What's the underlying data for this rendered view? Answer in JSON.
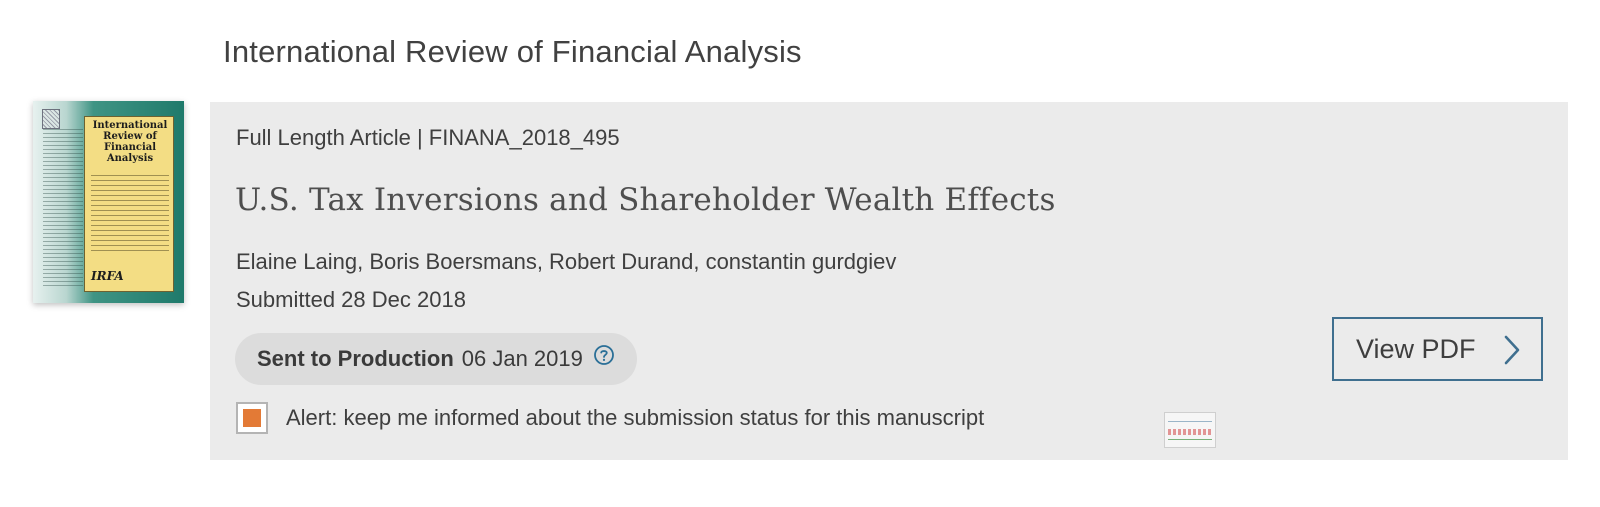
{
  "journal": {
    "title": "International Review of Financial Analysis",
    "cover": {
      "name_lines": "International\nReview of\nFinancial\nAnalysis",
      "abbreviation": "IRFA"
    }
  },
  "article": {
    "meta": "Full Length Article | FINANA_2018_495",
    "title": "U.S. Tax Inversions and Shareholder Wealth Effects",
    "authors": "Elaine Laing, Boris Boersmans, Robert Durand, constantin gurdgiev",
    "submitted": "Submitted 28 Dec 2018",
    "status": {
      "label": "Sent to Production",
      "date": "06 Jan 2019",
      "help_icon": "question-circle-icon"
    },
    "alert": {
      "checked": true,
      "text": "Alert: keep me informed about the submission status for this manuscript"
    },
    "actions": {
      "view_pdf_label": "View PDF",
      "view_pdf_icon": "chevron-right-icon"
    }
  },
  "colors": {
    "card_background": "#ebebeb",
    "status_pill_background": "#dcdcdc",
    "checkbox_fill": "#e37a36",
    "button_border": "#3f6f8f",
    "help_icon": "#2a6f97"
  }
}
